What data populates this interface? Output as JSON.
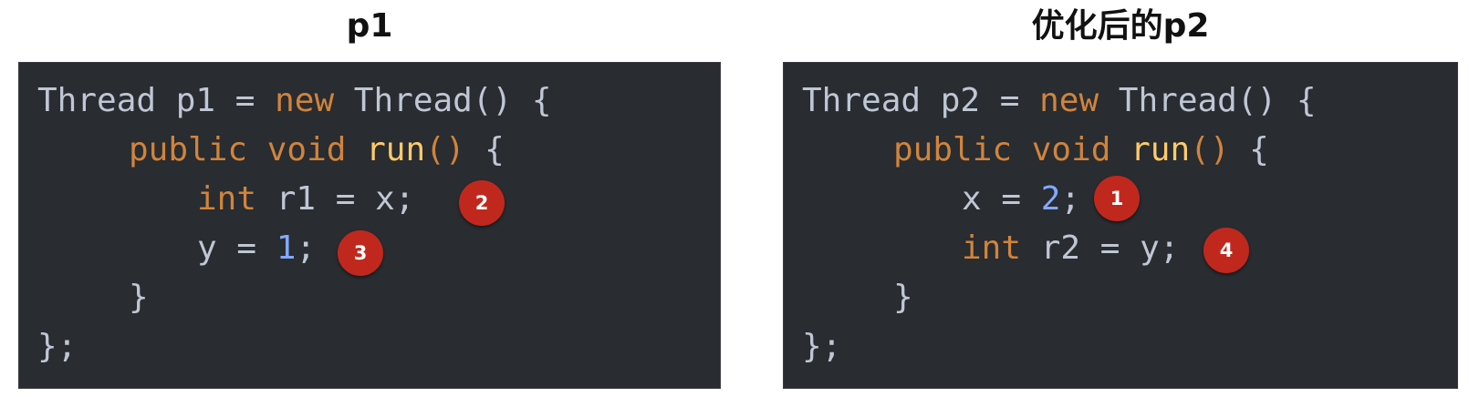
{
  "panels": [
    {
      "title": "p1",
      "code": {
        "line1": {
          "a": "Thread p1 = ",
          "b": "new",
          "c": " Thread() {"
        },
        "line2": {
          "a": "public void",
          "b": " ",
          "c": "run",
          "d": "()",
          "e": " {"
        },
        "line3": {
          "a": "int",
          "b": " r1 = x;"
        },
        "line4": {
          "a": "y = ",
          "b": "1",
          "c": ";"
        },
        "line5": {
          "a": "}"
        },
        "line6": {
          "a": "};"
        }
      },
      "badges": [
        "2",
        "3"
      ]
    },
    {
      "title": "优化后的p2",
      "code": {
        "line1": {
          "a": "Thread p2 = ",
          "b": "new",
          "c": " Thread() {"
        },
        "line2": {
          "a": "public void",
          "b": " ",
          "c": "run",
          "d": "()",
          "e": " {"
        },
        "line3": {
          "a": "x = ",
          "b": "2",
          "c": ";"
        },
        "line4": {
          "a": "int",
          "b": " r2 = y;"
        },
        "line5": {
          "a": "}"
        },
        "line6": {
          "a": "};"
        }
      },
      "badges": [
        "1",
        "4"
      ]
    }
  ],
  "colors": {
    "code_background": "#292c30",
    "keyword": "#d0843c",
    "function_name": "#ffcb6b",
    "number": "#82aaff",
    "plain_text": "#bfc7d5",
    "badge": "#c0281e"
  }
}
